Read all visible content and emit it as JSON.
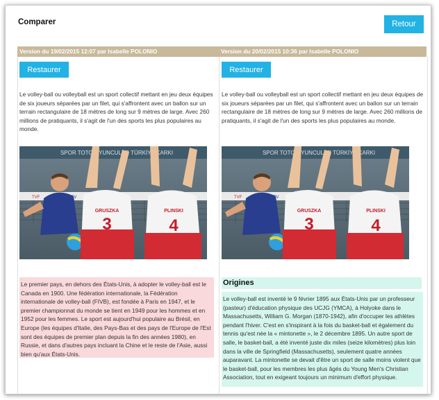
{
  "title": "Comparer",
  "retour_label": "Retour",
  "restore_label": "Restaurer",
  "left": {
    "header": "Version du 19/02/2015 12:07 par Isabelle POLONIO",
    "intro": "Le volley-ball ou volleyball est un sport collectif mettant en jeu deux équipes de six joueurs séparées par un filet, qui s'affrontent avec un ballon sur un terrain rectangulaire de 18 mètres de long sur 9 mètres de large. Avec 260 millions de pratiquants, il s'agit de l'un des sports les plus populaires au monde.",
    "removed": "Le premier pays, en dehors des États-Unis, à adopter le volley-ball est le Canada en 1900. Une fédération internationale, la Fédération internationale de volley-ball (FIVB), est fondée à Paris en 1947, et le premier championnat du monde se tient en 1949 pour les hommes et en 1952 pour les femmes. Le sport est aujourd'hui populaire au Brésil, en Europe (les équipes d'Italie, des Pays-Bas et des pays de l'Europe de l'Est sont des équipes de premier plan depuis la fin des années 1980), en Russie, et dans d'autres pays incluant la Chine et le reste de l'Asie, aussi bien qu'aux États-Unis."
  },
  "right": {
    "header": "Version du 20/02/2015 10:36 par Isabelle POLONIO",
    "intro": "Le volley-ball ou volleyball est un sport collectif mettant en jeu deux équipes de six joueurs séparées par un filet, qui s'affrontent avec un ballon sur un terrain rectangulaire de 18 mètres de long sur 9 mètres de large. Avec 260 millions de pratiquants, il s'agit de l'un des sports les plus populaires au monde.",
    "added_heading": "Origines",
    "added": "Le volley-ball est inventé le 9 février 1895 aux États-Unis par un professeur (pasteur) d'éducation physique des UCJG (YMCA), à Holyoke dans le Massachusetts, William G. Morgan (1870-1942), afin d'occuper les athlètes pendant l'hiver. C'est en s'inspirant à la fois du basket-ball et également du tennis qu'est née la « mintonette », le 2 décembre 1895. Un autre sport de salle, le basket-ball, a été inventé juste dix miles (seize kilomètres) plus loin dans la ville de Springfield (Massachusetts), seulement quatre années auparavant. La mintonette se devait d'être un sport de salle moins violent que le basket-ball, pour les membres les plus âgés du Young Men's Christian Association, tout en exigeant toujours un minimum d'effort physique."
  },
  "photo": {
    "banner_text": "SPOR TOTO ÖYUNCULAR TÜRKİYE KARKI",
    "jersey_left": "GRUSZKA",
    "jersey_left_number": "3",
    "jersey_right": "PLINSKI",
    "jersey_right_number": "4",
    "ad_tvf": "TVF",
    "ad_cev": "CEV"
  },
  "colors": {
    "accent": "#22b2e3",
    "header_bar": "#c8b99b",
    "removed_bg": "#f9d9dc",
    "added_bg": "#d5f6ed"
  }
}
